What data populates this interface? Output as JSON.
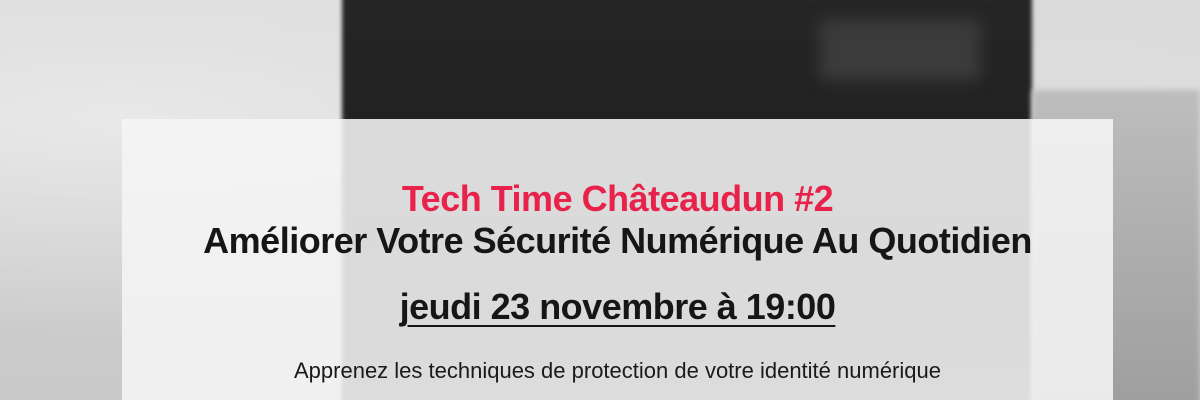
{
  "event": {
    "series": "Tech Time Châteaudun #2",
    "title": "Améliorer Votre Sécurité Numérique Au Quotidien",
    "date": "jeudi 23 novembre à 19:00",
    "description": "Apprenez les techniques de protection de votre identité numérique"
  },
  "colors": {
    "accent": "#e8224a",
    "text": "#161616",
    "card_background": "#f5f5f5"
  }
}
